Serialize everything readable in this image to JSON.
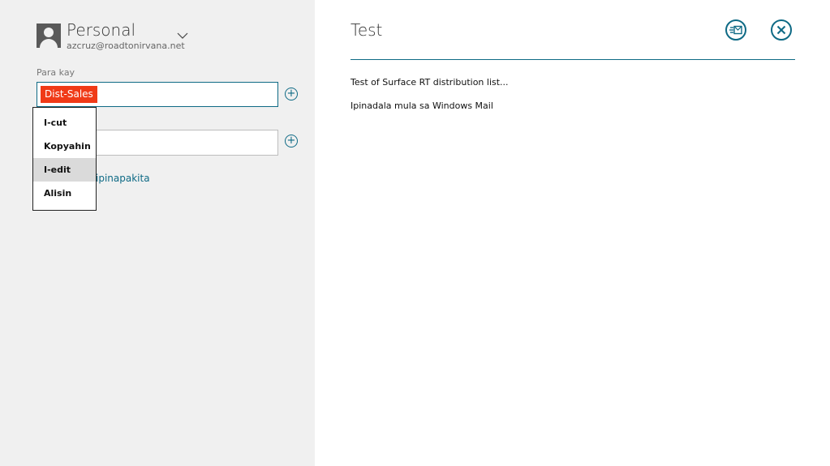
{
  "account": {
    "name": "Personal",
    "email": "azcruz@roadtonirvana.net"
  },
  "to": {
    "label": "Para kay",
    "chip": "Dist-Sales"
  },
  "cc": {
    "value": ""
  },
  "show_more": {
    "label": "ipinapakita"
  },
  "context_menu": {
    "items": [
      {
        "label": "I-cut"
      },
      {
        "label": "Kopyahin"
      },
      {
        "label": "I-edit"
      },
      {
        "label": "Alisin"
      }
    ],
    "hovered_index": 2
  },
  "message": {
    "subject": "Test",
    "body_line1": "Test of Surface RT distribution list...",
    "body_line2": "Ipinadala mula sa Windows Mail"
  },
  "colors": {
    "accent": "#0e6a85",
    "chip": "#f03a17",
    "left_pane_bg": "#f0f0f0"
  },
  "icons": {
    "account_chevron": "chevron-down-icon",
    "add": "plus-circle-icon",
    "send": "send-mail-icon",
    "close": "close-icon"
  }
}
